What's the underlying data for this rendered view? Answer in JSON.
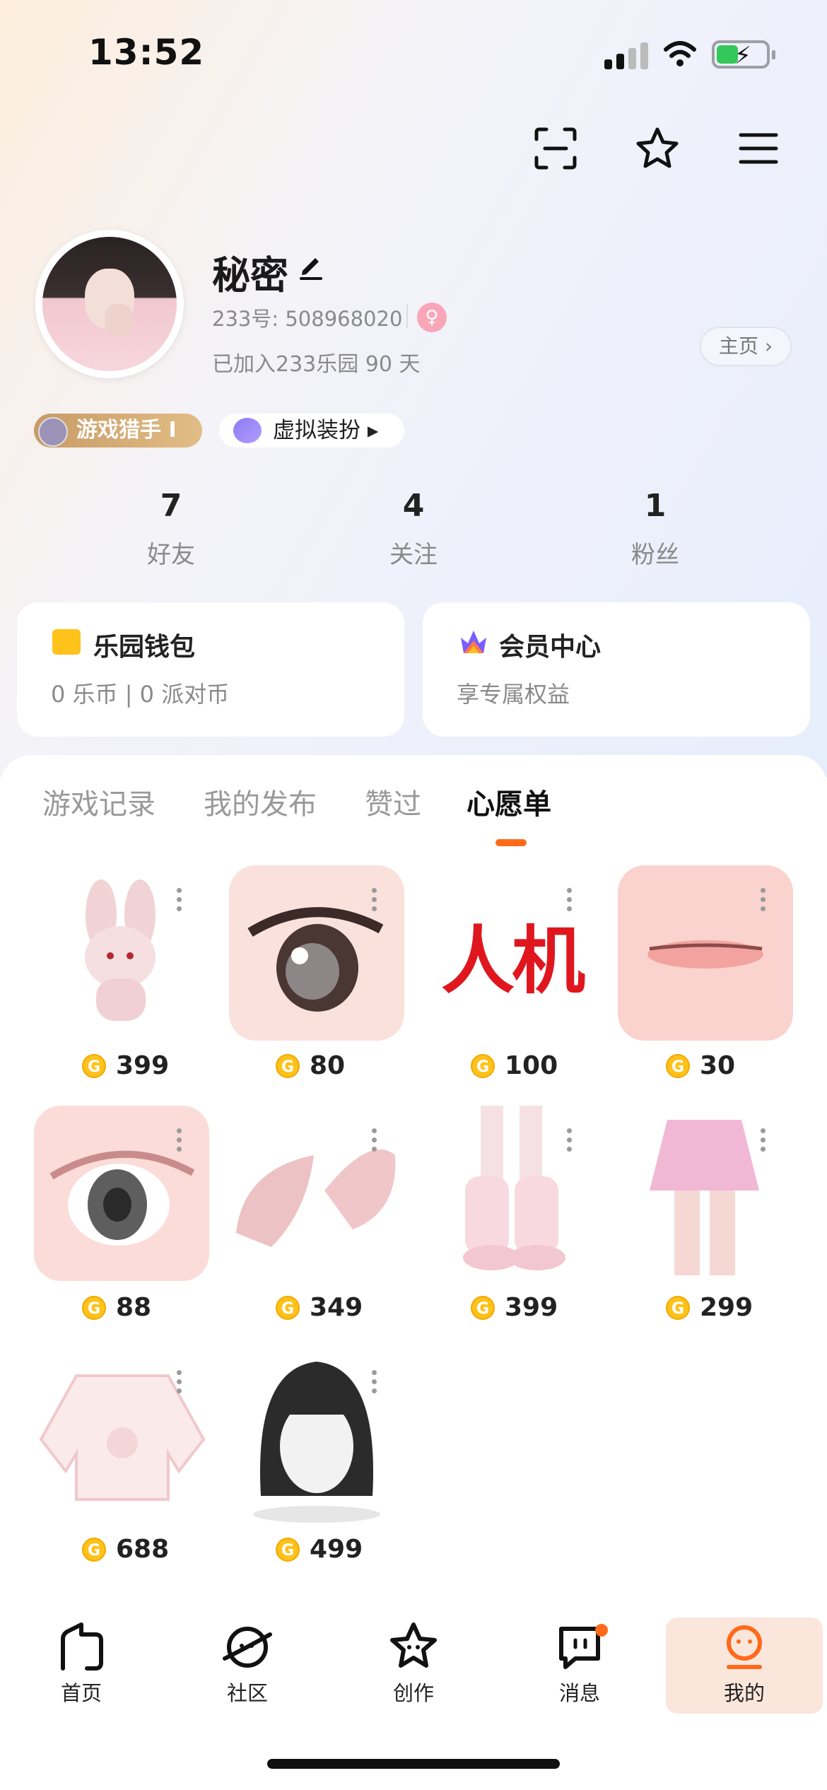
{
  "status_bar": {
    "time": "13:52"
  },
  "profile": {
    "username": "秘密",
    "uid_text": "233号: 508968020",
    "joined_text": "已加入233乐园 90 天",
    "homepage_label": "主页 ›"
  },
  "badges": {
    "title_badge": "游戏猎手 I",
    "avatar_badge": "虚拟装扮 ▸"
  },
  "stats": [
    {
      "value": "7",
      "label": "好友"
    },
    {
      "value": "4",
      "label": "关注"
    },
    {
      "value": "1",
      "label": "粉丝"
    }
  ],
  "cards": {
    "wallet": {
      "title": "乐园钱包",
      "subtitle": "0 乐币 | 0 派对币"
    },
    "vip": {
      "title": "会员中心",
      "subtitle": "享专属权益"
    }
  },
  "tabs": [
    {
      "label": "游戏记录"
    },
    {
      "label": "我的发布"
    },
    {
      "label": "赞过"
    },
    {
      "label": "心愿单",
      "active": true
    }
  ],
  "wishlist": [
    {
      "name": "pink bunny plush",
      "price": "399"
    },
    {
      "name": "anime eye",
      "price": "80"
    },
    {
      "name": "人机 text",
      "price": "100"
    },
    {
      "name": "lips",
      "price": "30"
    },
    {
      "name": "pink eye",
      "price": "88"
    },
    {
      "name": "fluffy cat ears",
      "price": "349"
    },
    {
      "name": "leg warmers",
      "price": "399"
    },
    {
      "name": "pink pleated skirt",
      "price": "299"
    },
    {
      "name": "bunny sweater",
      "price": "688"
    },
    {
      "name": "black long hair",
      "price": "499"
    }
  ],
  "wishlist_item3_text": "人机",
  "coin_symbol": "G",
  "nav": [
    {
      "label": "首页"
    },
    {
      "label": "社区"
    },
    {
      "label": "创作"
    },
    {
      "label": "消息"
    },
    {
      "label": "我的",
      "active": true
    }
  ],
  "colors": {
    "accent": "#ff6a1a",
    "coin": "#ffc21a",
    "badge_gold": "#c89b66"
  }
}
